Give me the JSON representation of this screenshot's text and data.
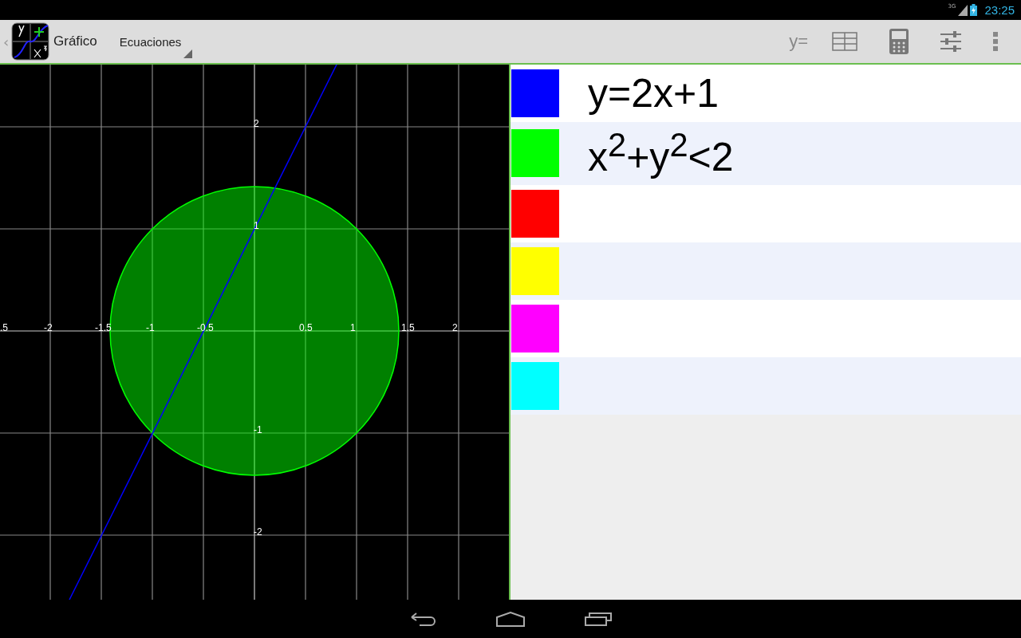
{
  "status_bar": {
    "network": "3G",
    "time": "23:25"
  },
  "action_bar": {
    "back": "‹",
    "title": "Gráfico",
    "dropdown": "Ecuaciones",
    "equals_button": "y="
  },
  "graph": {
    "x_tick_labels": [
      ".5",
      "-2",
      "-1.5",
      "-1",
      "-0.5",
      "0.5",
      "1",
      "1.5",
      "2"
    ],
    "y_tick_labels": [
      "2",
      "1",
      "-1",
      "-2"
    ]
  },
  "equations": [
    {
      "color": "#0000ff",
      "expression": "y=2x+1"
    },
    {
      "color": "#00ff00",
      "expression": "x$^{2}$+y$^{2}$<2"
    },
    {
      "color": "#ff0000"
    },
    {
      "color": "#ffff00"
    },
    {
      "color": "#ff00ff"
    },
    {
      "color": "#00ffff"
    }
  ]
}
